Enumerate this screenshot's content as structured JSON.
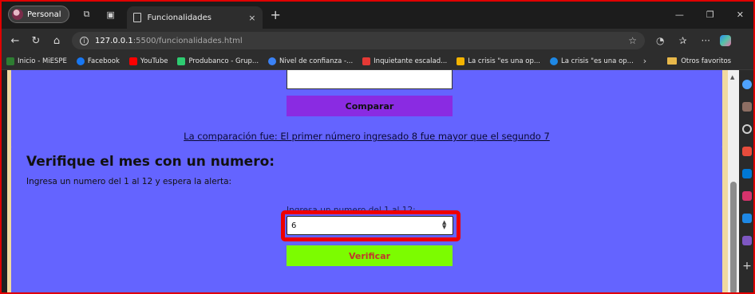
{
  "browser": {
    "profile_label": "Personal",
    "tab_title": "Funcionalidades",
    "tab_close": "×",
    "new_tab": "+",
    "url_host": "127.0.0.1",
    "url_rest": ":5500/funcionalidades.html",
    "bookmarks": [
      {
        "label": "Inicio - MiESPE",
        "color": "#2e7d32"
      },
      {
        "label": "Facebook",
        "color": "#1877f2"
      },
      {
        "label": "YouTube",
        "color": "#ff0000"
      },
      {
        "label": "Produbanco - Grup...",
        "color": "#2ecc71"
      },
      {
        "label": "Nivel de confianza -...",
        "color": "#3b82f6"
      },
      {
        "label": "Inquietante escalad...",
        "color": "#e53935"
      },
      {
        "label": "La crisis \"es una op...",
        "color": "#f4b400"
      },
      {
        "label": "La crisis \"es una op...",
        "color": "#1e88e5"
      }
    ],
    "other_favorites": "Otros favoritos"
  },
  "compare_section": {
    "button_label": "Comparar",
    "result_text": "La comparación fue: El primer número ingresado 8 fue mayor que el segundo 7"
  },
  "month_section": {
    "heading": "Verifique el mes con un numero:",
    "instructions": "Ingresa un numero del 1 al 12 y espera la alerta:",
    "field_label": "Ingresa un numero del 1 al 12:",
    "input_value": "6",
    "button_label": "Verificar"
  },
  "colors": {
    "page_background": "#f0d9a0",
    "card_background": "#6464ff",
    "compare_button": "#8a2be2",
    "verify_button": "#7cfc00",
    "highlight": "#ee0000"
  }
}
